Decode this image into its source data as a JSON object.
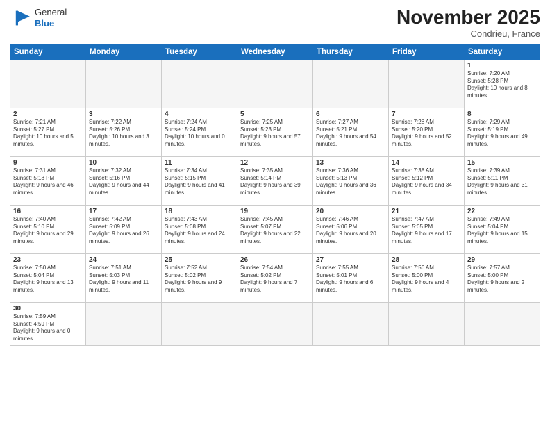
{
  "header": {
    "logo_general": "General",
    "logo_blue": "Blue",
    "month_title": "November 2025",
    "location": "Condrieu, France"
  },
  "days_of_week": [
    "Sunday",
    "Monday",
    "Tuesday",
    "Wednesday",
    "Thursday",
    "Friday",
    "Saturday"
  ],
  "weeks": [
    [
      {
        "num": "",
        "info": ""
      },
      {
        "num": "",
        "info": ""
      },
      {
        "num": "",
        "info": ""
      },
      {
        "num": "",
        "info": ""
      },
      {
        "num": "",
        "info": ""
      },
      {
        "num": "",
        "info": ""
      },
      {
        "num": "1",
        "info": "Sunrise: 7:20 AM\nSunset: 5:28 PM\nDaylight: 10 hours and 8 minutes."
      }
    ],
    [
      {
        "num": "2",
        "info": "Sunrise: 7:21 AM\nSunset: 5:27 PM\nDaylight: 10 hours and 5 minutes."
      },
      {
        "num": "3",
        "info": "Sunrise: 7:22 AM\nSunset: 5:26 PM\nDaylight: 10 hours and 3 minutes."
      },
      {
        "num": "4",
        "info": "Sunrise: 7:24 AM\nSunset: 5:24 PM\nDaylight: 10 hours and 0 minutes."
      },
      {
        "num": "5",
        "info": "Sunrise: 7:25 AM\nSunset: 5:23 PM\nDaylight: 9 hours and 57 minutes."
      },
      {
        "num": "6",
        "info": "Sunrise: 7:27 AM\nSunset: 5:21 PM\nDaylight: 9 hours and 54 minutes."
      },
      {
        "num": "7",
        "info": "Sunrise: 7:28 AM\nSunset: 5:20 PM\nDaylight: 9 hours and 52 minutes."
      },
      {
        "num": "8",
        "info": "Sunrise: 7:29 AM\nSunset: 5:19 PM\nDaylight: 9 hours and 49 minutes."
      }
    ],
    [
      {
        "num": "9",
        "info": "Sunrise: 7:31 AM\nSunset: 5:18 PM\nDaylight: 9 hours and 46 minutes."
      },
      {
        "num": "10",
        "info": "Sunrise: 7:32 AM\nSunset: 5:16 PM\nDaylight: 9 hours and 44 minutes."
      },
      {
        "num": "11",
        "info": "Sunrise: 7:34 AM\nSunset: 5:15 PM\nDaylight: 9 hours and 41 minutes."
      },
      {
        "num": "12",
        "info": "Sunrise: 7:35 AM\nSunset: 5:14 PM\nDaylight: 9 hours and 39 minutes."
      },
      {
        "num": "13",
        "info": "Sunrise: 7:36 AM\nSunset: 5:13 PM\nDaylight: 9 hours and 36 minutes."
      },
      {
        "num": "14",
        "info": "Sunrise: 7:38 AM\nSunset: 5:12 PM\nDaylight: 9 hours and 34 minutes."
      },
      {
        "num": "15",
        "info": "Sunrise: 7:39 AM\nSunset: 5:11 PM\nDaylight: 9 hours and 31 minutes."
      }
    ],
    [
      {
        "num": "16",
        "info": "Sunrise: 7:40 AM\nSunset: 5:10 PM\nDaylight: 9 hours and 29 minutes."
      },
      {
        "num": "17",
        "info": "Sunrise: 7:42 AM\nSunset: 5:09 PM\nDaylight: 9 hours and 26 minutes."
      },
      {
        "num": "18",
        "info": "Sunrise: 7:43 AM\nSunset: 5:08 PM\nDaylight: 9 hours and 24 minutes."
      },
      {
        "num": "19",
        "info": "Sunrise: 7:45 AM\nSunset: 5:07 PM\nDaylight: 9 hours and 22 minutes."
      },
      {
        "num": "20",
        "info": "Sunrise: 7:46 AM\nSunset: 5:06 PM\nDaylight: 9 hours and 20 minutes."
      },
      {
        "num": "21",
        "info": "Sunrise: 7:47 AM\nSunset: 5:05 PM\nDaylight: 9 hours and 17 minutes."
      },
      {
        "num": "22",
        "info": "Sunrise: 7:49 AM\nSunset: 5:04 PM\nDaylight: 9 hours and 15 minutes."
      }
    ],
    [
      {
        "num": "23",
        "info": "Sunrise: 7:50 AM\nSunset: 5:04 PM\nDaylight: 9 hours and 13 minutes."
      },
      {
        "num": "24",
        "info": "Sunrise: 7:51 AM\nSunset: 5:03 PM\nDaylight: 9 hours and 11 minutes."
      },
      {
        "num": "25",
        "info": "Sunrise: 7:52 AM\nSunset: 5:02 PM\nDaylight: 9 hours and 9 minutes."
      },
      {
        "num": "26",
        "info": "Sunrise: 7:54 AM\nSunset: 5:02 PM\nDaylight: 9 hours and 7 minutes."
      },
      {
        "num": "27",
        "info": "Sunrise: 7:55 AM\nSunset: 5:01 PM\nDaylight: 9 hours and 6 minutes."
      },
      {
        "num": "28",
        "info": "Sunrise: 7:56 AM\nSunset: 5:00 PM\nDaylight: 9 hours and 4 minutes."
      },
      {
        "num": "29",
        "info": "Sunrise: 7:57 AM\nSunset: 5:00 PM\nDaylight: 9 hours and 2 minutes."
      }
    ],
    [
      {
        "num": "30",
        "info": "Sunrise: 7:59 AM\nSunset: 4:59 PM\nDaylight: 9 hours and 0 minutes."
      },
      {
        "num": "",
        "info": ""
      },
      {
        "num": "",
        "info": ""
      },
      {
        "num": "",
        "info": ""
      },
      {
        "num": "",
        "info": ""
      },
      {
        "num": "",
        "info": ""
      },
      {
        "num": "",
        "info": ""
      }
    ]
  ]
}
